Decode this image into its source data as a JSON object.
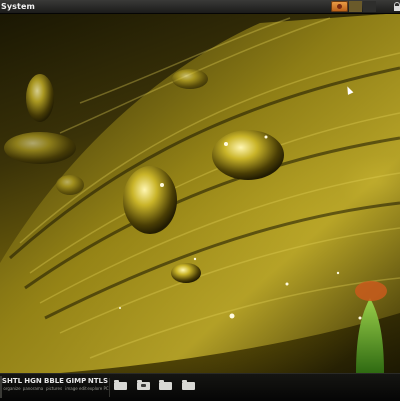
{
  "top_panel": {
    "menu_label": "System",
    "tray": [
      "media-player-icon",
      "applet-icon",
      "applet-icon-dark",
      "lock-icon"
    ]
  },
  "wallpaper": {
    "subject": "leaf-with-water-droplets",
    "palette": [
      "#1a1703",
      "#6e5f0c",
      "#d4c040",
      "#f5ea9a"
    ]
  },
  "dock": {
    "launchers": [
      {
        "abbr": "SHTL",
        "sub": "organize"
      },
      {
        "abbr": "HGN",
        "sub": "panorama"
      },
      {
        "abbr": "BBLE",
        "sub": "pictures"
      },
      {
        "abbr": "GIMP",
        "sub": "image edit"
      },
      {
        "abbr": "NTLS",
        "sub": "explore PC"
      }
    ],
    "folders": [
      "folder-icon",
      "music-folder-icon",
      "pictures-folder-icon",
      "downloads-folder-icon"
    ]
  }
}
